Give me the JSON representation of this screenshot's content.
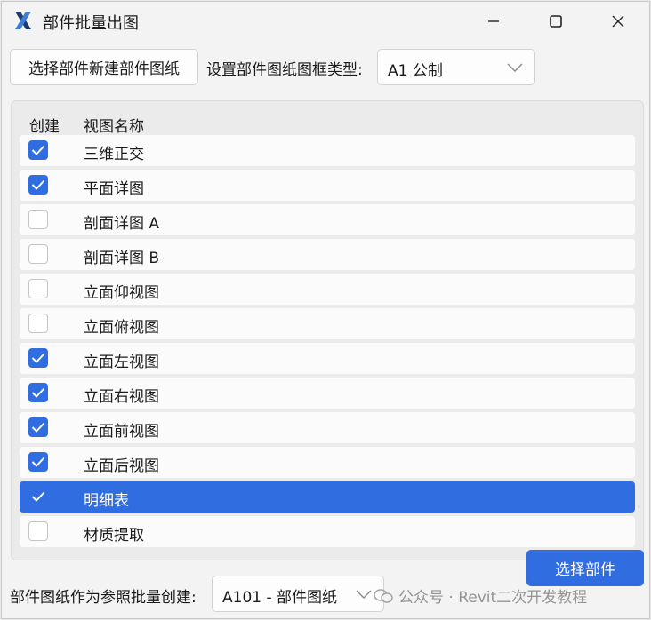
{
  "window": {
    "title": "部件批量出图",
    "app_icon": "x-logo-icon",
    "controls": [
      "minimize-icon",
      "maximize-icon",
      "close-icon"
    ]
  },
  "toolbar": {
    "new_sheet_button": "选择部件新建部件图纸",
    "titleblock_label": "设置部件图纸图框类型:",
    "titleblock_value": "A1 公制"
  },
  "view_list": {
    "header_create": "创建",
    "header_name": "视图名称",
    "rows": [
      {
        "name": "三维正交",
        "checked": true
      },
      {
        "name": "平面详图",
        "checked": true
      },
      {
        "name": "剖面详图 A",
        "checked": false
      },
      {
        "name": "剖面详图 B",
        "checked": false
      },
      {
        "name": "立面仰视图",
        "checked": false
      },
      {
        "name": "立面俯视图",
        "checked": false
      },
      {
        "name": "立面左视图",
        "checked": true
      },
      {
        "name": "立面右视图",
        "checked": true
      },
      {
        "name": "立面前视图",
        "checked": true
      },
      {
        "name": "立面后视图",
        "checked": true
      },
      {
        "name": "明细表",
        "checked": true,
        "selected": true
      },
      {
        "name": "材质提取",
        "checked": false
      }
    ]
  },
  "footer": {
    "reference_label": "部件图纸作为参照批量创建:",
    "reference_value": "A101 - 部件图纸",
    "select_button": "选择部件"
  },
  "watermark": "公众号 · Revit二次开发教程",
  "colors": {
    "accent": "#2f6de1",
    "window_bg": "#f3f3f3",
    "row_bg": "#fbfbfb"
  }
}
